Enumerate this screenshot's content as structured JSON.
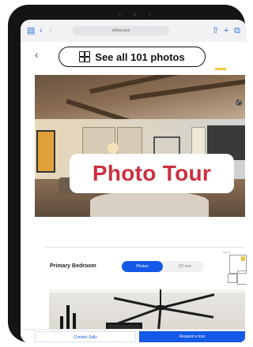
{
  "browser": {
    "url": "zillow.com"
  },
  "header": {
    "see_all_label": "See all 101 photos"
  },
  "overlay": {
    "title": "Photo Tour"
  },
  "section": {
    "title": "Primary Bedroom",
    "toggle_photos": "Photos",
    "toggle_3d": "3D tour",
    "floorplan_label": "Floor 1"
  },
  "footer": {
    "contact_label": "Contact Sally",
    "request_label": "Request a tour"
  },
  "colors": {
    "accent_blue": "#1458e8",
    "overlay_red": "#cc2f3f",
    "highlight_yellow": "#f5c842"
  }
}
